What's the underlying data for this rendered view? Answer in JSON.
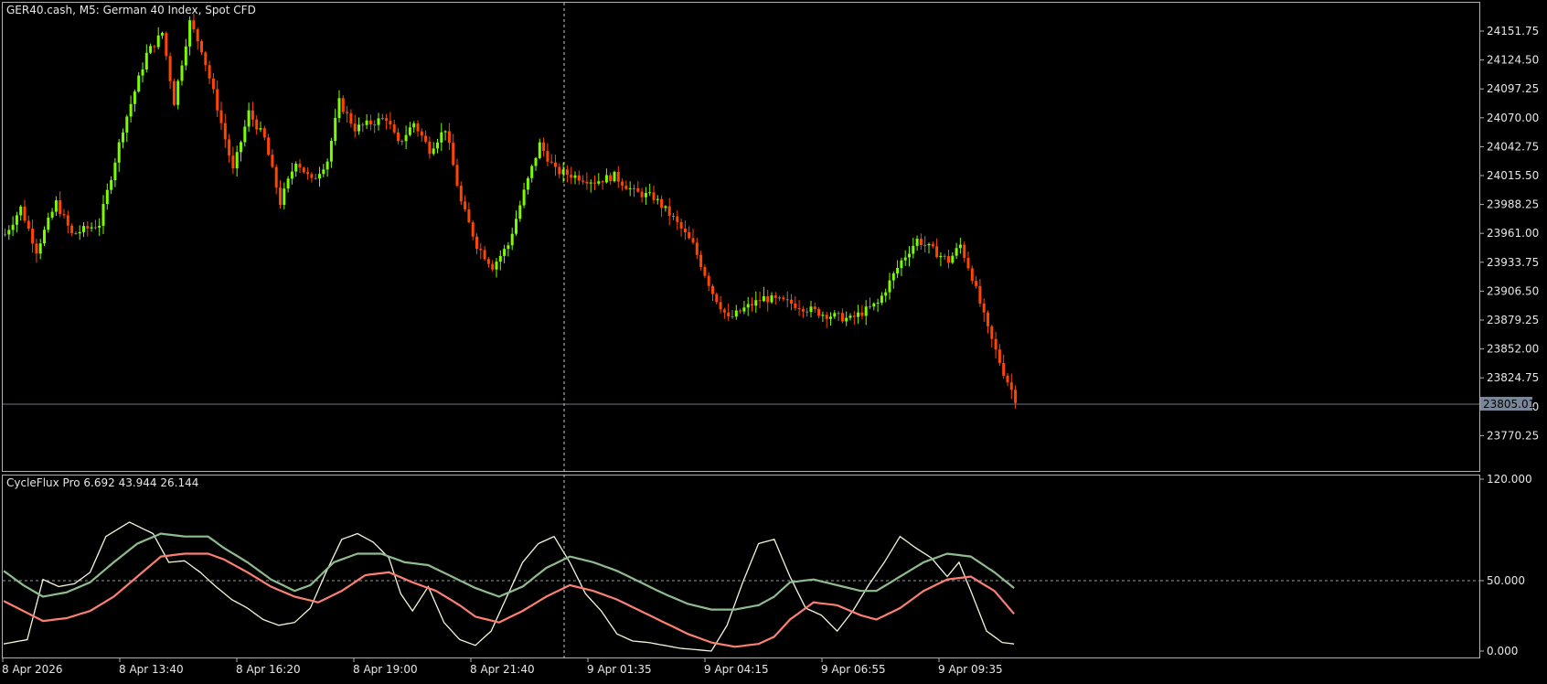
{
  "main_chart": {
    "symbol_label": "GER40.cash, M5:  German 40 Index, Spot CFD",
    "price_ticks": [
      "24151.75",
      "24124.50",
      "24097.25",
      "24070.00",
      "24042.75",
      "24015.50",
      "23988.25",
      "23961.00",
      "23933.75",
      "23906.50",
      "23879.25",
      "23852.00",
      "23824.75",
      "23797.50",
      "23770.25"
    ],
    "current_price": "23805.01",
    "colors": {
      "bull": "#7cfc00",
      "bear": "#ff4500",
      "neutral": "#808080",
      "bid_line": "#6f7a8a",
      "price_box": "#7a8799"
    }
  },
  "indicator": {
    "label": "CycleFlux Pro 6.692 43.944 26.144",
    "ticks": [
      "120.000",
      "50.000",
      "0.000"
    ],
    "colors": {
      "fast": "#f5f5dc",
      "slow": "#8fbc8f",
      "signal": "#fa8072"
    }
  },
  "time_axis": {
    "labels": [
      "8 Apr 2026",
      "8 Apr 13:40",
      "8 Apr 16:20",
      "8 Apr 19:00",
      "8 Apr 21:40",
      "9 Apr 01:35",
      "9 Apr 04:15",
      "9 Apr 06:55",
      "9 Apr 09:35"
    ]
  },
  "chart_data": {
    "type": "candlestick",
    "title": "GER40.cash, M5:  German 40 Index, Spot CFD",
    "price_range": [
      23750,
      24180
    ],
    "price_anchors": [
      [
        0,
        23960
      ],
      [
        4,
        23985
      ],
      [
        8,
        23945
      ],
      [
        13,
        23990
      ],
      [
        17,
        23960
      ],
      [
        24,
        23970
      ],
      [
        30,
        24060
      ],
      [
        36,
        24130
      ],
      [
        40,
        24150
      ],
      [
        43,
        24085
      ],
      [
        47,
        24160
      ],
      [
        50,
        24135
      ],
      [
        54,
        24080
      ],
      [
        58,
        24020
      ],
      [
        62,
        24075
      ],
      [
        66,
        24050
      ],
      [
        70,
        23990
      ],
      [
        74,
        24030
      ],
      [
        78,
        24010
      ],
      [
        82,
        24030
      ],
      [
        85,
        24085
      ],
      [
        89,
        24060
      ],
      [
        93,
        24065
      ],
      [
        97,
        24070
      ],
      [
        100,
        24045
      ],
      [
        104,
        24065
      ],
      [
        108,
        24040
      ],
      [
        112,
        24060
      ],
      [
        116,
        23990
      ],
      [
        120,
        23950
      ],
      [
        124,
        23930
      ],
      [
        128,
        23950
      ],
      [
        132,
        24000
      ],
      [
        136,
        24045
      ],
      [
        140,
        24020
      ],
      [
        145,
        24015
      ],
      [
        150,
        24010
      ],
      [
        155,
        24015
      ],
      [
        160,
        24000
      ],
      [
        165,
        23995
      ],
      [
        170,
        23975
      ],
      [
        175,
        23950
      ],
      [
        180,
        23905
      ],
      [
        184,
        23880
      ],
      [
        188,
        23890
      ],
      [
        193,
        23900
      ],
      [
        200,
        23895
      ],
      [
        208,
        23885
      ],
      [
        215,
        23880
      ],
      [
        222,
        23895
      ],
      [
        228,
        23935
      ],
      [
        232,
        23955
      ],
      [
        236,
        23945
      ],
      [
        240,
        23935
      ],
      [
        243,
        23950
      ],
      [
        246,
        23920
      ],
      [
        250,
        23870
      ],
      [
        254,
        23830
      ],
      [
        257,
        23805
      ]
    ],
    "indicator_range": [
      0,
      120
    ],
    "hline": 50,
    "series": [
      {
        "name": "fast",
        "values": [
          [
            0,
            5
          ],
          [
            6,
            8
          ],
          [
            10,
            50
          ],
          [
            14,
            45
          ],
          [
            18,
            47
          ],
          [
            22,
            55
          ],
          [
            26,
            80
          ],
          [
            32,
            90
          ],
          [
            38,
            82
          ],
          [
            42,
            62
          ],
          [
            46,
            63
          ],
          [
            50,
            55
          ],
          [
            54,
            45
          ],
          [
            58,
            36
          ],
          [
            62,
            30
          ],
          [
            66,
            22
          ],
          [
            70,
            18
          ],
          [
            74,
            20
          ],
          [
            78,
            30
          ],
          [
            82,
            55
          ],
          [
            86,
            78
          ],
          [
            90,
            82
          ],
          [
            94,
            76
          ],
          [
            98,
            65
          ],
          [
            101,
            40
          ],
          [
            104,
            28
          ],
          [
            108,
            45
          ],
          [
            112,
            20
          ],
          [
            116,
            8
          ],
          [
            120,
            4
          ],
          [
            124,
            14
          ],
          [
            128,
            38
          ],
          [
            132,
            62
          ],
          [
            136,
            75
          ],
          [
            140,
            80
          ],
          [
            144,
            62
          ],
          [
            148,
            40
          ],
          [
            152,
            28
          ],
          [
            156,
            12
          ],
          [
            160,
            7
          ],
          [
            164,
            6
          ],
          [
            168,
            4
          ],
          [
            172,
            2
          ],
          [
            176,
            1
          ],
          [
            180,
            0
          ],
          [
            184,
            18
          ],
          [
            188,
            48
          ],
          [
            192,
            75
          ],
          [
            196,
            78
          ],
          [
            200,
            52
          ],
          [
            204,
            30
          ],
          [
            208,
            25
          ],
          [
            212,
            14
          ],
          [
            216,
            28
          ],
          [
            220,
            46
          ],
          [
            224,
            62
          ],
          [
            228,
            80
          ],
          [
            232,
            72
          ],
          [
            236,
            65
          ],
          [
            240,
            52
          ],
          [
            243,
            62
          ],
          [
            246,
            42
          ],
          [
            250,
            14
          ],
          [
            254,
            6
          ],
          [
            257,
            5
          ]
        ]
      },
      {
        "name": "slow",
        "values": [
          [
            0,
            56
          ],
          [
            5,
            46
          ],
          [
            10,
            38
          ],
          [
            16,
            41
          ],
          [
            22,
            48
          ],
          [
            28,
            62
          ],
          [
            34,
            75
          ],
          [
            40,
            82
          ],
          [
            46,
            80
          ],
          [
            52,
            80
          ],
          [
            56,
            72
          ],
          [
            62,
            62
          ],
          [
            68,
            50
          ],
          [
            74,
            42
          ],
          [
            78,
            46
          ],
          [
            84,
            62
          ],
          [
            90,
            68
          ],
          [
            96,
            68
          ],
          [
            102,
            62
          ],
          [
            108,
            60
          ],
          [
            114,
            52
          ],
          [
            120,
            44
          ],
          [
            126,
            38
          ],
          [
            132,
            45
          ],
          [
            138,
            58
          ],
          [
            144,
            66
          ],
          [
            150,
            62
          ],
          [
            156,
            56
          ],
          [
            162,
            48
          ],
          [
            168,
            40
          ],
          [
            174,
            33
          ],
          [
            180,
            29
          ],
          [
            186,
            29
          ],
          [
            192,
            32
          ],
          [
            196,
            38
          ],
          [
            200,
            48
          ],
          [
            206,
            50
          ],
          [
            212,
            46
          ],
          [
            218,
            42
          ],
          [
            222,
            42
          ],
          [
            228,
            52
          ],
          [
            234,
            62
          ],
          [
            240,
            68
          ],
          [
            246,
            66
          ],
          [
            252,
            55
          ],
          [
            257,
            44
          ]
        ]
      },
      {
        "name": "signal",
        "values": [
          [
            0,
            35
          ],
          [
            5,
            28
          ],
          [
            10,
            21
          ],
          [
            16,
            23
          ],
          [
            22,
            28
          ],
          [
            28,
            38
          ],
          [
            34,
            52
          ],
          [
            40,
            66
          ],
          [
            46,
            68
          ],
          [
            52,
            68
          ],
          [
            56,
            64
          ],
          [
            62,
            55
          ],
          [
            68,
            45
          ],
          [
            74,
            38
          ],
          [
            80,
            34
          ],
          [
            86,
            42
          ],
          [
            92,
            53
          ],
          [
            98,
            55
          ],
          [
            104,
            48
          ],
          [
            110,
            42
          ],
          [
            116,
            32
          ],
          [
            120,
            24
          ],
          [
            126,
            20
          ],
          [
            132,
            28
          ],
          [
            138,
            38
          ],
          [
            144,
            46
          ],
          [
            150,
            42
          ],
          [
            156,
            36
          ],
          [
            162,
            28
          ],
          [
            168,
            20
          ],
          [
            174,
            12
          ],
          [
            180,
            6
          ],
          [
            186,
            3
          ],
          [
            192,
            5
          ],
          [
            196,
            10
          ],
          [
            200,
            22
          ],
          [
            206,
            34
          ],
          [
            212,
            32
          ],
          [
            218,
            25
          ],
          [
            222,
            22
          ],
          [
            228,
            30
          ],
          [
            234,
            42
          ],
          [
            240,
            50
          ],
          [
            246,
            52
          ],
          [
            252,
            42
          ],
          [
            257,
            26
          ]
        ]
      }
    ]
  }
}
